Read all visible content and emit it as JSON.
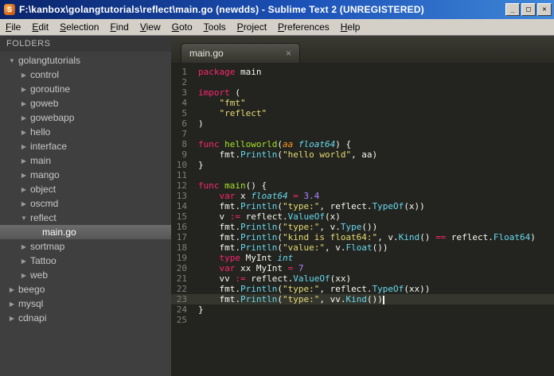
{
  "window": {
    "title": "F:\\kanbox\\golangtutorials\\reflect\\main.go (newdds) - Sublime Text 2 (UNREGISTERED)",
    "icon_letter": "S",
    "controls": {
      "minimize": "_",
      "maximize": "□",
      "close": "✕"
    }
  },
  "menu": {
    "items": [
      "File",
      "Edit",
      "Selection",
      "Find",
      "View",
      "Goto",
      "Tools",
      "Project",
      "Preferences",
      "Help"
    ]
  },
  "icons": {
    "folder_collapsed": "▶",
    "folder_expanded": "▼",
    "tab_close": "×"
  },
  "sidebar": {
    "header": "FOLDERS",
    "items": [
      {
        "label": "golangtutorials",
        "depth": 0,
        "kind": "folder",
        "expanded": true,
        "selected": false
      },
      {
        "label": "control",
        "depth": 1,
        "kind": "folder",
        "expanded": false,
        "selected": false
      },
      {
        "label": "goroutine",
        "depth": 1,
        "kind": "folder",
        "expanded": false,
        "selected": false
      },
      {
        "label": "goweb",
        "depth": 1,
        "kind": "folder",
        "expanded": false,
        "selected": false
      },
      {
        "label": "gowebapp",
        "depth": 1,
        "kind": "folder",
        "expanded": false,
        "selected": false
      },
      {
        "label": "hello",
        "depth": 1,
        "kind": "folder",
        "expanded": false,
        "selected": false
      },
      {
        "label": "interface",
        "depth": 1,
        "kind": "folder",
        "expanded": false,
        "selected": false
      },
      {
        "label": "main",
        "depth": 1,
        "kind": "folder",
        "expanded": false,
        "selected": false
      },
      {
        "label": "mango",
        "depth": 1,
        "kind": "folder",
        "expanded": false,
        "selected": false
      },
      {
        "label": "object",
        "depth": 1,
        "kind": "folder",
        "expanded": false,
        "selected": false
      },
      {
        "label": "oscmd",
        "depth": 1,
        "kind": "folder",
        "expanded": false,
        "selected": false
      },
      {
        "label": "reflect",
        "depth": 1,
        "kind": "folder",
        "expanded": true,
        "selected": false
      },
      {
        "label": "main.go",
        "depth": 2,
        "kind": "file",
        "expanded": false,
        "selected": true
      },
      {
        "label": "sortmap",
        "depth": 1,
        "kind": "folder",
        "expanded": false,
        "selected": false
      },
      {
        "label": "Tattoo",
        "depth": 1,
        "kind": "folder",
        "expanded": false,
        "selected": false
      },
      {
        "label": "web",
        "depth": 1,
        "kind": "folder",
        "expanded": false,
        "selected": false
      },
      {
        "label": "beego",
        "depth": 0,
        "kind": "folder",
        "expanded": false,
        "selected": false
      },
      {
        "label": "mysql",
        "depth": 0,
        "kind": "folder",
        "expanded": false,
        "selected": false
      },
      {
        "label": "cdnapi",
        "depth": 0,
        "kind": "folder",
        "expanded": false,
        "selected": false
      }
    ]
  },
  "editor": {
    "tab": {
      "label": "main.go"
    },
    "current_line": 23,
    "lines": [
      {
        "num": 1,
        "segments": [
          [
            "kw",
            "package"
          ],
          [
            "plain",
            " main"
          ]
        ]
      },
      {
        "num": 2,
        "segments": []
      },
      {
        "num": 3,
        "segments": [
          [
            "kw",
            "import"
          ],
          [
            "plain",
            " ("
          ]
        ]
      },
      {
        "num": 4,
        "segments": [
          [
            "plain",
            "    "
          ],
          [
            "str",
            "\"fmt\""
          ]
        ]
      },
      {
        "num": 5,
        "segments": [
          [
            "plain",
            "    "
          ],
          [
            "str",
            "\"reflect\""
          ]
        ]
      },
      {
        "num": 6,
        "segments": [
          [
            "plain",
            ")"
          ]
        ]
      },
      {
        "num": 7,
        "segments": []
      },
      {
        "num": 8,
        "segments": [
          [
            "kw",
            "func"
          ],
          [
            "plain",
            " "
          ],
          [
            "fn",
            "helloworld"
          ],
          [
            "plain",
            "("
          ],
          [
            "param",
            "aa"
          ],
          [
            "plain",
            " "
          ],
          [
            "type",
            "float64"
          ],
          [
            "plain",
            ") {"
          ]
        ]
      },
      {
        "num": 9,
        "segments": [
          [
            "plain",
            "    fmt."
          ],
          [
            "support",
            "Println"
          ],
          [
            "plain",
            "("
          ],
          [
            "str",
            "\"hello world\""
          ],
          [
            "plain",
            ", aa)"
          ]
        ]
      },
      {
        "num": 10,
        "segments": [
          [
            "plain",
            "}"
          ]
        ]
      },
      {
        "num": 11,
        "segments": []
      },
      {
        "num": 12,
        "segments": [
          [
            "kw",
            "func"
          ],
          [
            "plain",
            " "
          ],
          [
            "fn",
            "main"
          ],
          [
            "plain",
            "() {"
          ]
        ]
      },
      {
        "num": 13,
        "segments": [
          [
            "plain",
            "    "
          ],
          [
            "kw",
            "var"
          ],
          [
            "plain",
            " x "
          ],
          [
            "type",
            "float64"
          ],
          [
            "plain",
            " "
          ],
          [
            "kw",
            "="
          ],
          [
            "plain",
            " "
          ],
          [
            "num",
            "3.4"
          ]
        ]
      },
      {
        "num": 14,
        "segments": [
          [
            "plain",
            "    fmt."
          ],
          [
            "support",
            "Println"
          ],
          [
            "plain",
            "("
          ],
          [
            "str",
            "\"type:\""
          ],
          [
            "plain",
            ", reflect."
          ],
          [
            "support",
            "TypeOf"
          ],
          [
            "plain",
            "(x))"
          ]
        ]
      },
      {
        "num": 15,
        "segments": [
          [
            "plain",
            "    v "
          ],
          [
            "kw",
            ":="
          ],
          [
            "plain",
            " reflect."
          ],
          [
            "support",
            "ValueOf"
          ],
          [
            "plain",
            "(x)"
          ]
        ]
      },
      {
        "num": 16,
        "segments": [
          [
            "plain",
            "    fmt."
          ],
          [
            "support",
            "Println"
          ],
          [
            "plain",
            "("
          ],
          [
            "str",
            "\"type:\""
          ],
          [
            "plain",
            ", v."
          ],
          [
            "support",
            "Type"
          ],
          [
            "plain",
            "())"
          ]
        ]
      },
      {
        "num": 17,
        "segments": [
          [
            "plain",
            "    fmt."
          ],
          [
            "support",
            "Println"
          ],
          [
            "plain",
            "("
          ],
          [
            "str",
            "\"kind is float64:\""
          ],
          [
            "plain",
            ", v."
          ],
          [
            "support",
            "Kind"
          ],
          [
            "plain",
            "() "
          ],
          [
            "kw",
            "=="
          ],
          [
            "plain",
            " reflect."
          ],
          [
            "support",
            "Float64"
          ],
          [
            "plain",
            ")"
          ]
        ]
      },
      {
        "num": 18,
        "segments": [
          [
            "plain",
            "    fmt."
          ],
          [
            "support",
            "Println"
          ],
          [
            "plain",
            "("
          ],
          [
            "str",
            "\"value:\""
          ],
          [
            "plain",
            ", v."
          ],
          [
            "support",
            "Float"
          ],
          [
            "plain",
            "())"
          ]
        ]
      },
      {
        "num": 19,
        "segments": [
          [
            "plain",
            "    "
          ],
          [
            "kw",
            "type"
          ],
          [
            "plain",
            " MyInt "
          ],
          [
            "type",
            "int"
          ]
        ]
      },
      {
        "num": 20,
        "segments": [
          [
            "plain",
            "    "
          ],
          [
            "kw",
            "var"
          ],
          [
            "plain",
            " xx MyInt "
          ],
          [
            "kw",
            "="
          ],
          [
            "plain",
            " "
          ],
          [
            "num",
            "7"
          ]
        ]
      },
      {
        "num": 21,
        "segments": [
          [
            "plain",
            "    vv "
          ],
          [
            "kw",
            ":="
          ],
          [
            "plain",
            " reflect."
          ],
          [
            "support",
            "ValueOf"
          ],
          [
            "plain",
            "(xx)"
          ]
        ]
      },
      {
        "num": 22,
        "segments": [
          [
            "plain",
            "    fmt."
          ],
          [
            "support",
            "Println"
          ],
          [
            "plain",
            "("
          ],
          [
            "str",
            "\"type:\""
          ],
          [
            "plain",
            ", reflect."
          ],
          [
            "support",
            "TypeOf"
          ],
          [
            "plain",
            "(xx))"
          ]
        ]
      },
      {
        "num": 23,
        "segments": [
          [
            "plain",
            "    fmt."
          ],
          [
            "support",
            "Println"
          ],
          [
            "plain",
            "("
          ],
          [
            "str",
            "\"type:\""
          ],
          [
            "plain",
            ", vv."
          ],
          [
            "support",
            "Kind"
          ],
          [
            "plain",
            "())"
          ]
        ]
      },
      {
        "num": 24,
        "segments": [
          [
            "plain",
            "}"
          ]
        ]
      },
      {
        "num": 25,
        "segments": []
      }
    ]
  },
  "colors": {
    "editor_background": "#23241f",
    "keyword": "#f92672",
    "string": "#e6db74",
    "number": "#ae81ff",
    "function_name": "#a6e22e",
    "support_function": "#66d9ef",
    "type_italic": "#66d9ef",
    "parameter": "#fd971f",
    "foreground": "#f8f8f2",
    "titlebar_left": "#0a246a",
    "titlebar_right": "#3f87d8",
    "menubar_background": "#d4d0c8",
    "sidebar_background": "#3f3f3f"
  }
}
